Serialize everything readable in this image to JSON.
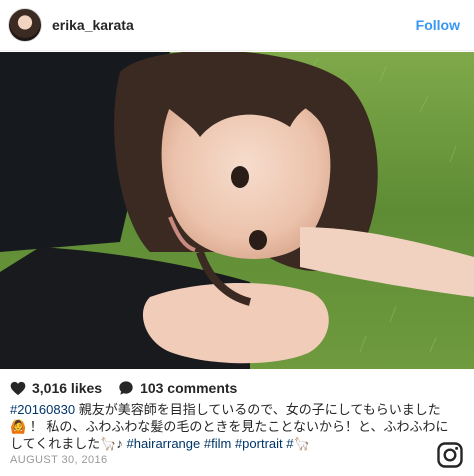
{
  "header": {
    "username": "erika_karata",
    "follow_label": "Follow"
  },
  "post": {
    "photo_icon": "photo",
    "likes": "3,016 likes",
    "comments": "103 comments",
    "caption": {
      "line1_tag": "#20160830",
      "line1_text": " 親友が美容師を目指しているので、女の子にしてもらいました",
      "line2_text": "🙆 ！ 私の、ふわふわな髪の毛のときを見たことないから！と、ふわふわに",
      "line3_text": "してくれました🦙♪ ",
      "tag_hairarrange": "#hairarrange",
      "tag_film": "#film",
      "tag_portrait": "#portrait",
      "tag_llama": "#🦙"
    },
    "date": "August 30, 2016"
  },
  "icons": {
    "heart": "heart-icon",
    "comment": "comment-icon",
    "instagram": "instagram-icon"
  },
  "colors": {
    "follow": "#3897f0",
    "hashtag": "#003569",
    "muted": "#999999"
  }
}
